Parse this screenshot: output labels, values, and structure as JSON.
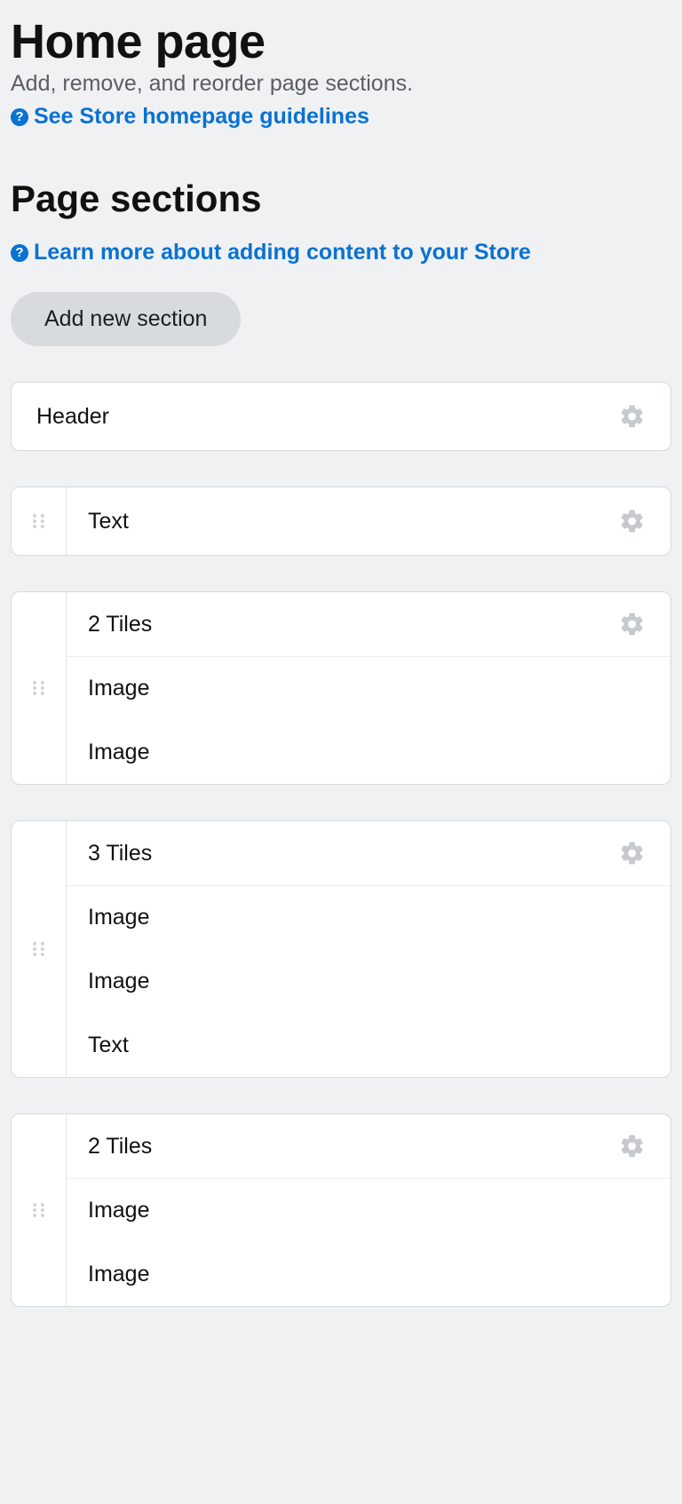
{
  "header": {
    "title": "Home page",
    "subtitle": "Add, remove, and reorder page sections.",
    "guidelines_link": "See Store homepage guidelines"
  },
  "sections_panel": {
    "heading": "Page sections",
    "learn_link": "Learn more about adding content to your Store",
    "add_button": "Add new section",
    "sections": [
      {
        "title": "Header",
        "draggable": false,
        "settings": true,
        "children": []
      },
      {
        "title": "Text",
        "draggable": true,
        "settings": true,
        "children": []
      },
      {
        "title": "2 Tiles",
        "draggable": true,
        "settings": true,
        "children": [
          "Image",
          "Image"
        ]
      },
      {
        "title": "3 Tiles",
        "draggable": true,
        "settings": true,
        "children": [
          "Image",
          "Image",
          "Text"
        ]
      },
      {
        "title": "2 Tiles",
        "draggable": true,
        "settings": true,
        "children": [
          "Image",
          "Image"
        ]
      }
    ]
  }
}
